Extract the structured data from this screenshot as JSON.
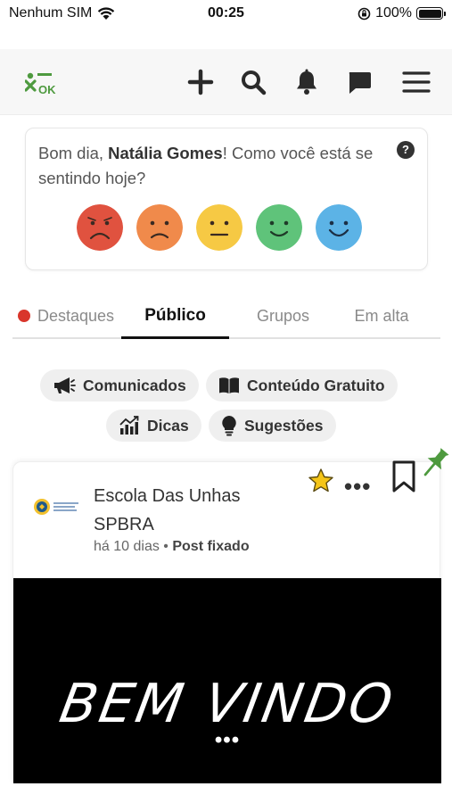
{
  "status_bar": {
    "carrier": "Nenhum SIM",
    "time": "00:25",
    "battery": "100%"
  },
  "header": {
    "logo_text": "OK",
    "icons": [
      "plus-icon",
      "search-icon",
      "bell-icon",
      "chat-icon",
      "menu-icon"
    ]
  },
  "mood": {
    "greeting": "Bom dia, ",
    "user_name": "Natália Gomes",
    "question": "! Como você está se sentindo hoje?",
    "faces": [
      {
        "name": "very-sad",
        "color": "#e0523f"
      },
      {
        "name": "sad",
        "color": "#f08a4b"
      },
      {
        "name": "neutral",
        "color": "#f6c944"
      },
      {
        "name": "happy",
        "color": "#5fc37a"
      },
      {
        "name": "very-happy",
        "color": "#5cb3e6"
      }
    ]
  },
  "tabs": [
    {
      "label": "Destaques",
      "has_dot": true
    },
    {
      "label": "Público",
      "active": true
    },
    {
      "label": "Grupos"
    },
    {
      "label": "Em alta"
    }
  ],
  "chips": [
    "Comunicados",
    "Conteúdo Gratuito",
    "Dicas",
    "Sugestões"
  ],
  "post": {
    "author": "Escola Das Unhas SPBRA",
    "time": "há 10 dias",
    "separator": "•",
    "pinned_label": "Post fixado",
    "more": "•••",
    "media_text": "BEM VINDO",
    "media_more": "•••"
  },
  "colors": {
    "accent_green": "#4e9a3f",
    "star": "#f5c518"
  }
}
